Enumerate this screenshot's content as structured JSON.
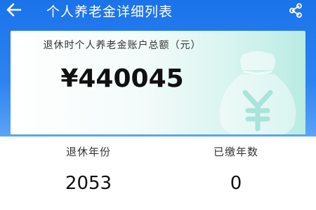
{
  "header": {
    "back_icon": "arrow-left-icon",
    "title": "个人养老金详细列表",
    "share_icon": "share-icon"
  },
  "summary": {
    "label": "退休时个人养老金账户总额（元）",
    "amount": "¥440045",
    "illustration": "money-bag-yuan-icon"
  },
  "stats": {
    "retirement_year_label": "退休年份",
    "retirement_year_value": "2053",
    "paid_years_label": "已缴年数",
    "paid_years_value": "0"
  },
  "colors": {
    "header_blue": "#1b73ea",
    "card_teal": "#b9ebe3",
    "text_dark": "#111111"
  }
}
